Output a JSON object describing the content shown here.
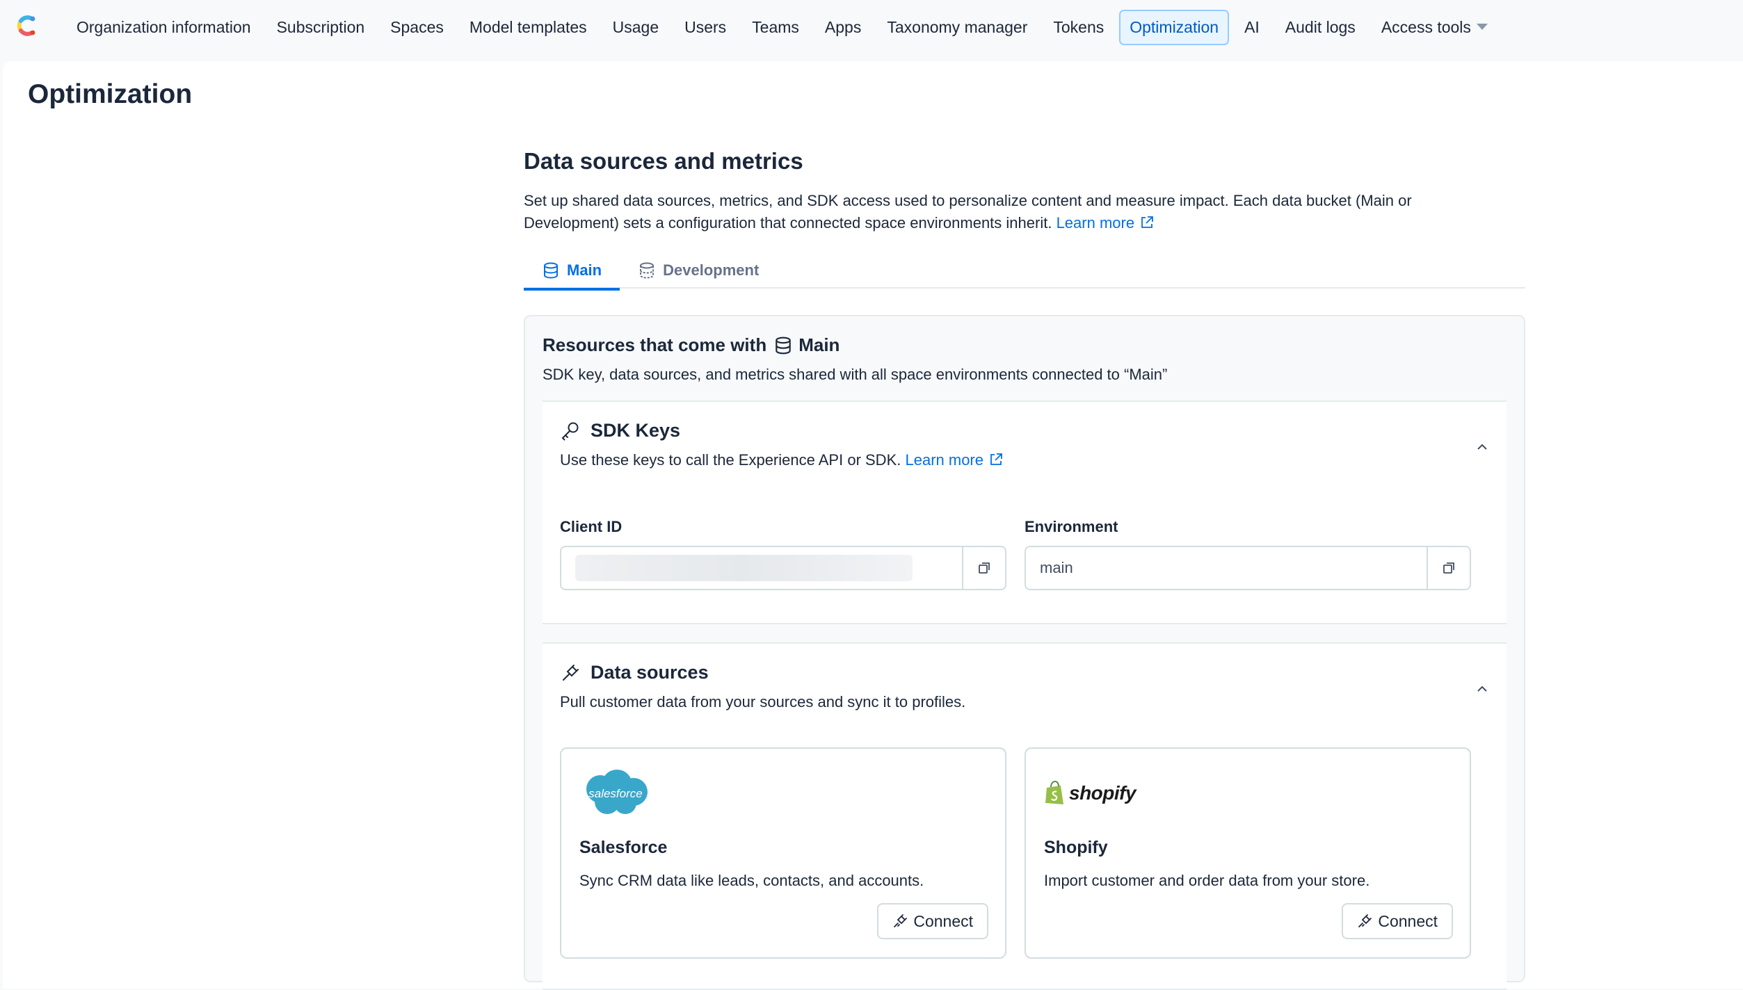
{
  "nav": {
    "items": [
      {
        "label": "Organization information"
      },
      {
        "label": "Subscription"
      },
      {
        "label": "Spaces"
      },
      {
        "label": "Model templates"
      },
      {
        "label": "Usage"
      },
      {
        "label": "Users"
      },
      {
        "label": "Teams"
      },
      {
        "label": "Apps"
      },
      {
        "label": "Taxonomy manager"
      },
      {
        "label": "Tokens"
      },
      {
        "label": "Optimization"
      },
      {
        "label": "AI"
      },
      {
        "label": "Audit logs"
      },
      {
        "label": "Access tools"
      }
    ],
    "active": "Optimization",
    "accent_color": "#036fe3"
  },
  "page": {
    "title": "Optimization"
  },
  "section": {
    "title": "Data sources and metrics",
    "description": "Set up shared data sources, metrics, and SDK access used to personalize content and measure impact. Each data bucket (Main or Development) sets a configuration that connected space environments inherit.",
    "learn_more": "Learn more"
  },
  "tabs": [
    {
      "label": "Main",
      "icon": "database-icon"
    },
    {
      "label": "Development",
      "icon": "database-dev-icon"
    }
  ],
  "resources": {
    "title_prefix": "Resources that come with",
    "bucket": "Main",
    "description": "SDK key, data sources, and metrics shared with all space environments connected to “Main”"
  },
  "sdk": {
    "title": "SDK Keys",
    "description": "Use these keys to call the Experience API or SDK.",
    "learn_more": "Learn more",
    "client_id_label": "Client ID",
    "environment_label": "Environment",
    "environment_value": "main"
  },
  "data_sources": {
    "title": "Data sources",
    "description": "Pull customer data from your sources and sync it to profiles.",
    "cards": [
      {
        "logo_text": "salesforce",
        "name": "Salesforce",
        "description": "Sync CRM data like leads, contacts, and accounts.",
        "button": "Connect"
      },
      {
        "logo_text": "shopify",
        "name": "Shopify",
        "description": "Import customer and order data from your store.",
        "button": "Connect"
      }
    ]
  }
}
